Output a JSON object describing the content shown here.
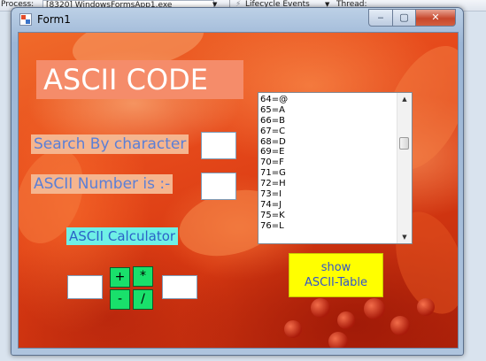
{
  "vs_toolbar": {
    "process_label": "Process:",
    "process_value": "[8320] WindowsFormsApp1.exe",
    "lifecycle": "Lifecycle Events",
    "thread_label": "Thread:"
  },
  "window": {
    "title": "Form1",
    "minimize_glyph": "‒",
    "maximize_glyph": "▢",
    "close_glyph": "✕"
  },
  "form": {
    "heading": "ASCII CODE",
    "search_label": "Search By character",
    "search_value": "",
    "ascii_number_label": "ASCII Number  is :-",
    "ascii_number_value": "",
    "calculator_label": "ASCII Calculator",
    "calc_left_value": "",
    "calc_right_value": "",
    "operators": {
      "plus": "+",
      "multiply": "*",
      "minus": "-",
      "divide": "/"
    },
    "show_table_line1": "show",
    "show_table_line2": "ASCII-Table"
  },
  "ascii_list": {
    "items": [
      "64=@",
      "65=A",
      "66=B",
      "67=C",
      "68=D",
      "69=E",
      "70=F",
      "71=G",
      "72=H",
      "73=I",
      "74=J",
      "75=K",
      "76=L"
    ],
    "scroll_up": "▲",
    "scroll_down": "▼"
  },
  "colors": {
    "heading_bg": "#f58c6a",
    "label_bg": "#f5b58f",
    "label_text": "#5b7fd6",
    "calc_label_bg": "#6ff0e6",
    "operator_bg": "#19e06b",
    "show_button_bg": "#ffff00",
    "close_button": "#c7472c"
  }
}
